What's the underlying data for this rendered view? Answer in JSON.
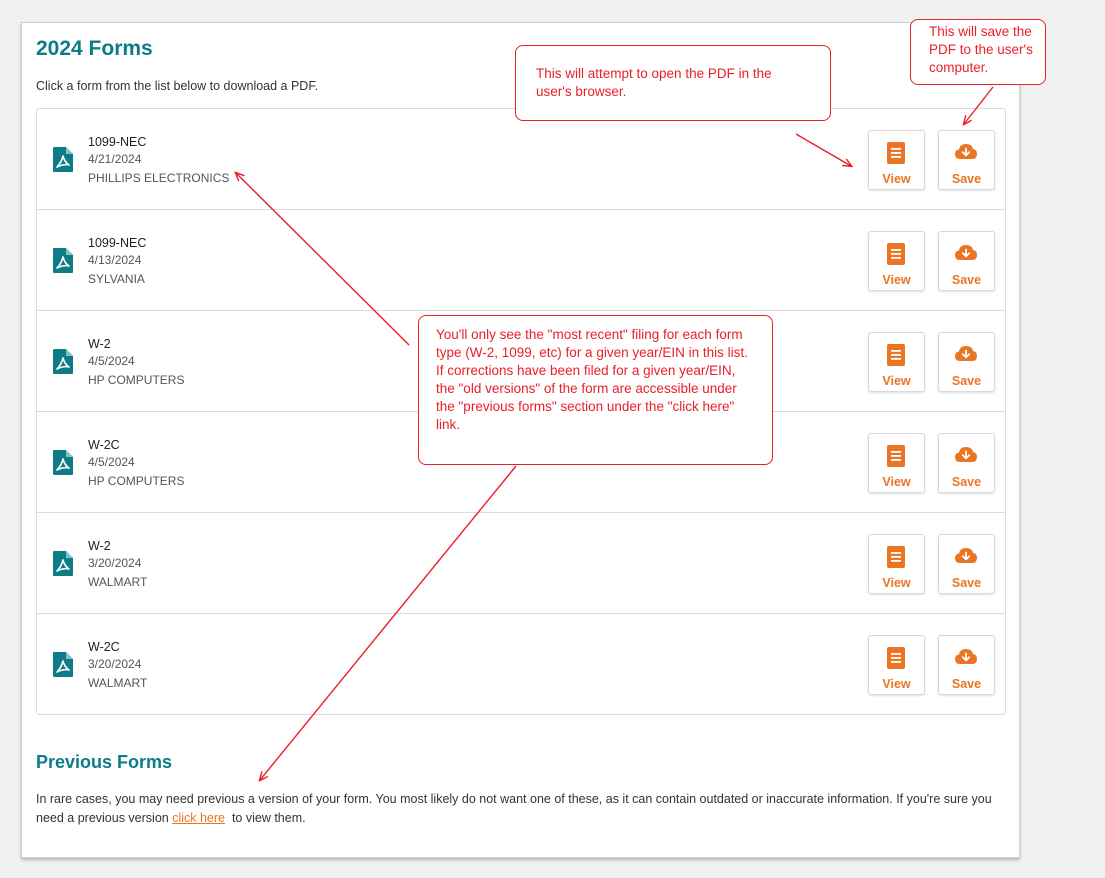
{
  "page": {
    "title": "2024 Forms",
    "intro": "Click a form from the list below to download a PDF."
  },
  "forms": [
    {
      "type": "1099-NEC",
      "date": "4/21/2024",
      "employer": "PHILLIPS ELECTRONICS"
    },
    {
      "type": "1099-NEC",
      "date": "4/13/2024",
      "employer": "SYLVANIA"
    },
    {
      "type": "W-2",
      "date": "4/5/2024",
      "employer": "HP COMPUTERS"
    },
    {
      "type": "W-2C",
      "date": "4/5/2024",
      "employer": "HP COMPUTERS"
    },
    {
      "type": "W-2",
      "date": "3/20/2024",
      "employer": "WALMART"
    },
    {
      "type": "W-2C",
      "date": "3/20/2024",
      "employer": "WALMART"
    }
  ],
  "actions": {
    "view_label": "View",
    "save_label": "Save"
  },
  "previous": {
    "title": "Previous Forms",
    "text_before": "In rare cases, you may need previous a version of your form. You most likely do not want one of these, as it can contain outdated or inaccurate information. If you're sure you need a previous version ",
    "link_label": "click here",
    "text_after": "  to view them."
  },
  "annotations": {
    "view_note": "This will attempt to open the PDF in the user's browser.",
    "save_note": "This will save the PDF to the user's computer.",
    "list_note": "You'll only see the \"most recent\" filing for each form type (W-2, 1099, etc) for a given year/EIN in this list. If corrections have been filed for a given year/EIN, the \"old versions\" of the form are accessible under the \"previous forms\" section under the \"click here\" link."
  },
  "icons": {
    "pdf": "pdf-file-icon",
    "view": "document-icon",
    "save": "cloud-download-icon"
  },
  "colors": {
    "heading": "#0e7c86",
    "pdf_icon": "#0e7c86",
    "accent": "#ea7524",
    "annotation": "#e8202a"
  }
}
